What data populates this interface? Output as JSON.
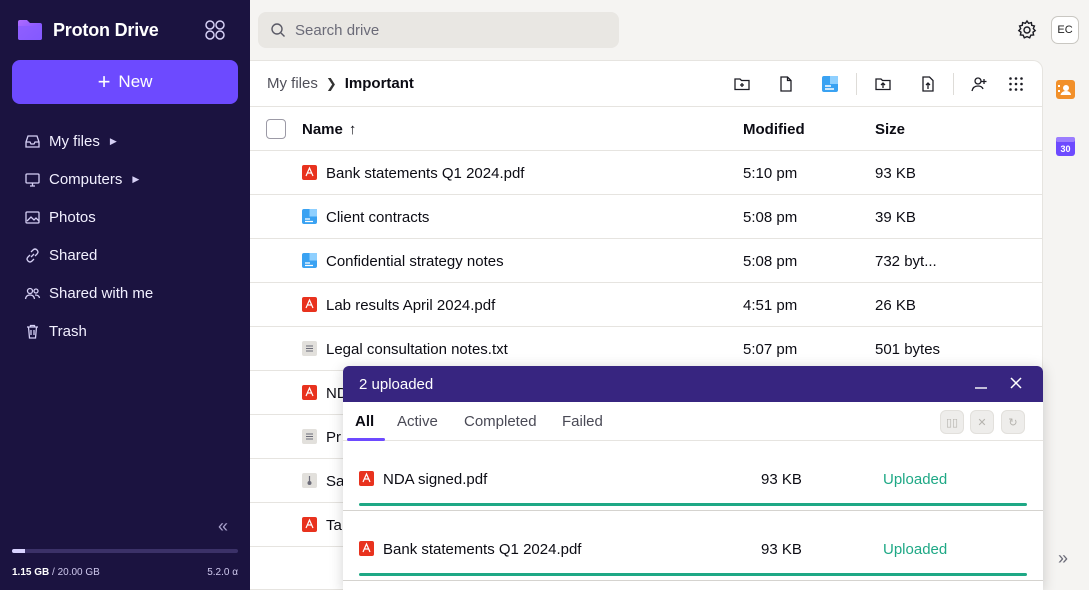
{
  "app": {
    "name": "Proton Drive",
    "version": "5.2.0 α"
  },
  "sidebar": {
    "new_label": "New",
    "items": [
      {
        "label": "My files",
        "icon": "inbox-icon",
        "has_caret": true
      },
      {
        "label": "Computers",
        "icon": "computer-icon",
        "has_caret": true
      },
      {
        "label": "Photos",
        "icon": "image-icon",
        "has_caret": false
      },
      {
        "label": "Shared",
        "icon": "link-icon",
        "has_caret": false
      },
      {
        "label": "Shared with me",
        "icon": "users-icon",
        "has_caret": false
      },
      {
        "label": "Trash",
        "icon": "trash-icon",
        "has_caret": false
      }
    ],
    "storage": {
      "used": "1.15 GB",
      "total": "20.00 GB",
      "fraction": 0.0575
    }
  },
  "search": {
    "placeholder": "Search drive"
  },
  "user": {
    "initials": "EC"
  },
  "breadcrumb": {
    "parent": "My files",
    "current": "Important"
  },
  "table": {
    "headers": {
      "name": "Name",
      "modified": "Modified",
      "size": "Size"
    },
    "rows": [
      {
        "name": "Bank statements Q1 2024.pdf",
        "type": "pdf",
        "modified": "5:10 pm",
        "size": "93 KB"
      },
      {
        "name": "Client contracts",
        "type": "doc",
        "modified": "5:08 pm",
        "size": "39 KB"
      },
      {
        "name": "Confidential strategy notes",
        "type": "doc",
        "modified": "5:08 pm",
        "size": "732 byt..."
      },
      {
        "name": "Lab results April 2024.pdf",
        "type": "pdf",
        "modified": "4:51 pm",
        "size": "26 KB"
      },
      {
        "name": "Legal consultation notes.txt",
        "type": "txt",
        "modified": "5:07 pm",
        "size": "501 bytes"
      },
      {
        "name": "ND",
        "type": "pdf",
        "modified": "",
        "size": ""
      },
      {
        "name": "Pr",
        "type": "txt",
        "modified": "",
        "size": ""
      },
      {
        "name": "Sa",
        "type": "other",
        "modified": "",
        "size": ""
      },
      {
        "name": "Ta",
        "type": "pdf",
        "modified": "",
        "size": ""
      }
    ]
  },
  "uploader": {
    "title": "2 uploaded",
    "tabs": [
      "All",
      "Active",
      "Completed",
      "Failed"
    ],
    "active_tab": "All",
    "items": [
      {
        "name": "NDA signed.pdf",
        "size": "93 KB",
        "status": "Uploaded",
        "progress": 1.0
      },
      {
        "name": "Bank statements Q1 2024.pdf",
        "size": "93 KB",
        "status": "Uploaded",
        "progress": 1.0
      }
    ]
  },
  "colors": {
    "accent": "#6d4aff",
    "sidebar": "#1b1340",
    "uploader_header": "#372580",
    "success": "#1ea885",
    "pdf": "#e8321e"
  }
}
